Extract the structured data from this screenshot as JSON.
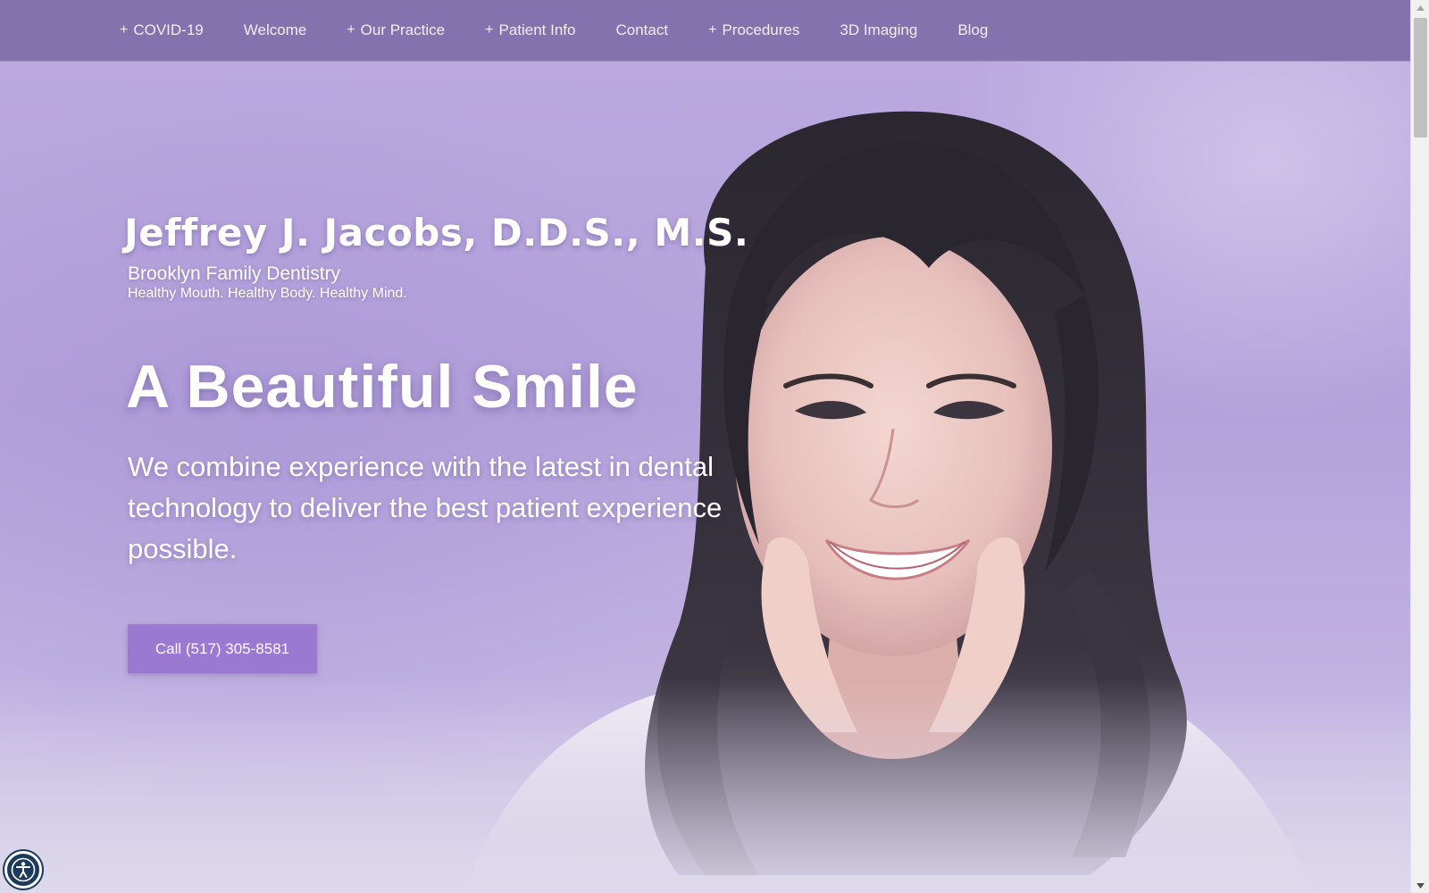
{
  "nav": {
    "items": [
      {
        "label": "COVID-19",
        "has_submenu": true,
        "prefix": "+"
      },
      {
        "label": "Welcome",
        "has_submenu": false,
        "prefix": ""
      },
      {
        "label": "Our Practice",
        "has_submenu": true,
        "prefix": "+"
      },
      {
        "label": "Patient Info",
        "has_submenu": true,
        "prefix": "+"
      },
      {
        "label": "Contact",
        "has_submenu": false,
        "prefix": ""
      },
      {
        "label": "Procedures",
        "has_submenu": true,
        "prefix": "+"
      },
      {
        "label": "3D Imaging",
        "has_submenu": false,
        "prefix": ""
      },
      {
        "label": "Blog",
        "has_submenu": false,
        "prefix": ""
      }
    ]
  },
  "brand": {
    "name": "Jeffrey J. Jacobs, D.D.S., M.S.",
    "practice": "Brooklyn Family Dentistry",
    "tagline": "Healthy Mouth. Healthy Body. Healthy Mind."
  },
  "hero": {
    "headline": "A Beautiful Smile",
    "description": "We combine experience with the latest in dental technology to deliver the best patient experience possible.",
    "cta_label": "Call (517) 305-8581"
  },
  "icons": {
    "accessibility": "accessibility-icon",
    "scroll_up": "scroll-up-arrow-icon",
    "scroll_down": "scroll-down-arrow-icon"
  },
  "colors": {
    "nav_bg": "#8372ad",
    "hero_bg": "#b3a1db",
    "cta_bg": "#9b78d2",
    "text": "#ffffff",
    "a11y_bg": "#1b3a5c"
  }
}
